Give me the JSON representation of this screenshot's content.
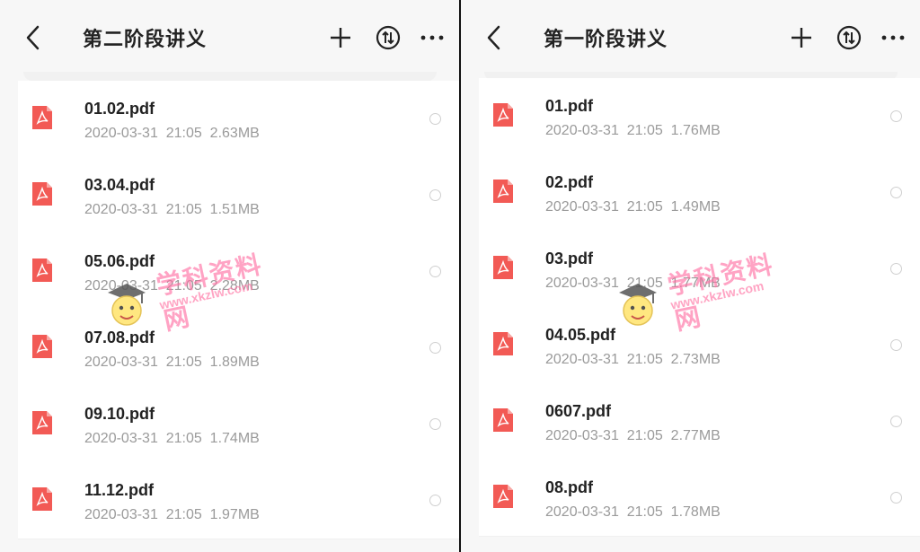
{
  "left_panel": {
    "title": "第二阶段讲义",
    "files": [
      {
        "name": "01.02.pdf",
        "date": "2020-03-31",
        "time": "21:05",
        "size": "2.63MB"
      },
      {
        "name": "03.04.pdf",
        "date": "2020-03-31",
        "time": "21:05",
        "size": "1.51MB"
      },
      {
        "name": "05.06.pdf",
        "date": "2020-03-31",
        "time": "21:05",
        "size": "2.28MB"
      },
      {
        "name": "07.08.pdf",
        "date": "2020-03-31",
        "time": "21:05",
        "size": "1.89MB"
      },
      {
        "name": "09.10.pdf",
        "date": "2020-03-31",
        "time": "21:05",
        "size": "1.74MB"
      },
      {
        "name": "11.12.pdf",
        "date": "2020-03-31",
        "time": "21:05",
        "size": "1.97MB"
      }
    ]
  },
  "right_panel": {
    "title": "第一阶段讲义",
    "files": [
      {
        "name": "01.pdf",
        "date": "2020-03-31",
        "time": "21:05",
        "size": "1.76MB"
      },
      {
        "name": "02.pdf",
        "date": "2020-03-31",
        "time": "21:05",
        "size": "1.49MB"
      },
      {
        "name": "03.pdf",
        "date": "2020-03-31",
        "time": "21:05",
        "size": "1.77MB"
      },
      {
        "name": "04.05.pdf",
        "date": "2020-03-31",
        "time": "21:05",
        "size": "2.73MB"
      },
      {
        "name": "0607.pdf",
        "date": "2020-03-31",
        "time": "21:05",
        "size": "2.77MB"
      },
      {
        "name": "08.pdf",
        "date": "2020-03-31",
        "time": "21:05",
        "size": "1.78MB"
      }
    ]
  },
  "icons": {
    "back": "chevron-left-icon",
    "add": "plus-icon",
    "sort": "sort-icon",
    "more": "more-icon",
    "file": "pdf-file-icon",
    "select": "radio-circle-icon"
  },
  "colors": {
    "pdf_icon": "#f25a55",
    "title_text": "#222222",
    "meta_text": "#9a9a9a",
    "background": "#f7f7f7",
    "watermark": "#ff6fa3"
  },
  "watermark": {
    "title": "学科资料网",
    "url": "www.xkzlw.com"
  }
}
